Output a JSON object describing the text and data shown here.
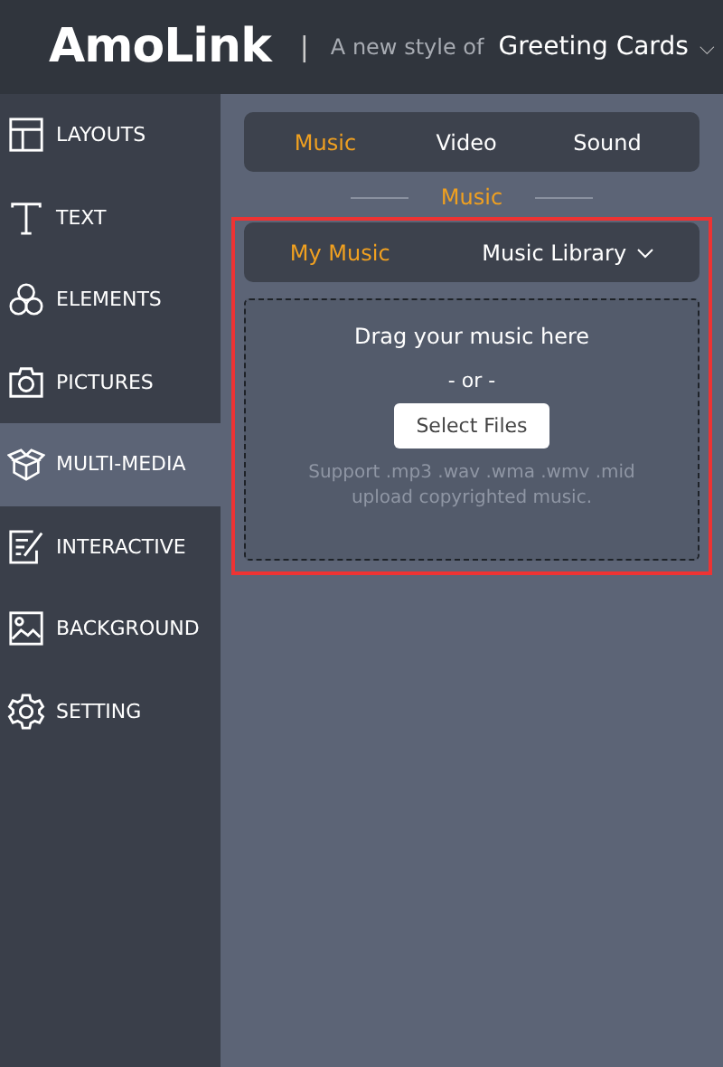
{
  "header": {
    "logo": "AmoLink",
    "separator": "|",
    "tagline": "A new style of",
    "product": "Greeting Cards",
    "caret": "⌵"
  },
  "sidebar": {
    "items": [
      {
        "kind": "layouts",
        "label": "LAYOUTS",
        "selected": false
      },
      {
        "kind": "text",
        "label": "TEXT",
        "selected": false
      },
      {
        "kind": "elements",
        "label": "ELEMENTS",
        "selected": false
      },
      {
        "kind": "pictures",
        "label": "PICTURES",
        "selected": false
      },
      {
        "kind": "multimedia",
        "label": "MULTI-MEDIA",
        "selected": true
      },
      {
        "kind": "interactive",
        "label": "INTERACTIVE",
        "selected": false
      },
      {
        "kind": "background",
        "label": "BACKGROUND",
        "selected": false
      },
      {
        "kind": "setting",
        "label": "SETTING",
        "selected": false
      }
    ]
  },
  "tabs": [
    {
      "label": "Music",
      "selected": true
    },
    {
      "label": "Video",
      "selected": false
    },
    {
      "label": "Sound",
      "selected": false
    }
  ],
  "section_title": "Music",
  "subtabs": [
    {
      "label": "My Music",
      "selected": true,
      "dropdown": false
    },
    {
      "label": "Music Library",
      "selected": false,
      "dropdown": true
    }
  ],
  "dropzone": {
    "title": "Drag your music here",
    "or": "- or -",
    "button": "Select Files",
    "note": "Support .mp3 .wav .wma .wmv .mid upload copyrighted music."
  }
}
